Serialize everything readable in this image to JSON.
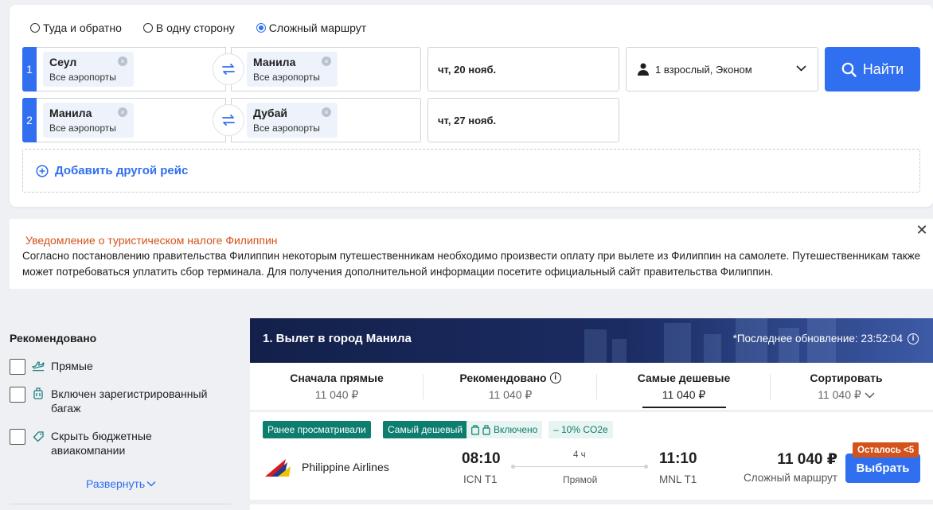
{
  "search": {
    "trip_types": [
      {
        "label": "Туда и обратно",
        "checked": false
      },
      {
        "label": "В одну сторону",
        "checked": false
      },
      {
        "label": "Сложный маршрут",
        "checked": true
      }
    ],
    "legs": [
      {
        "num": "1",
        "from": {
          "city": "Сеул",
          "sub": "Все аэропорты"
        },
        "to": {
          "city": "Манила",
          "sub": "Все аэропорты"
        },
        "date": "чт, 20 нояб."
      },
      {
        "num": "2",
        "from": {
          "city": "Манила",
          "sub": "Все аэропорты"
        },
        "to": {
          "city": "Дубай",
          "sub": "Все аэропорты"
        },
        "date": "чт, 27 нояб."
      }
    ],
    "passengers": "1 взрослый, Эконом",
    "search_label": "Найти",
    "add_flight_label": "Добавить другой рейс",
    "accent_color": "#2f6ff0"
  },
  "notice": {
    "title": "Уведомление о туристическом налоге Филиппин",
    "body": "Согласно постановлению правительства Филиппин некоторым путешественникам необходимо произвести оплату при вылете из Филиппин на самолете. Путешественникам также может потребоваться уплатить сбор терминала. Для получения дополнительной информации посетите официальный сайт правительства Филиппин.",
    "title_color": "#d4531b"
  },
  "filters": {
    "title": "Рекомендовано",
    "items": [
      {
        "label": "Прямые",
        "icon": "plane-icon"
      },
      {
        "label": "Включен зарегистрированный багаж",
        "icon": "luggage-icon"
      },
      {
        "label": "Скрыть бюджетные авиакомпании",
        "icon": "tag-icon"
      }
    ],
    "expand_label": "Развернуть"
  },
  "results": {
    "title": "1. Вылет в город Манила",
    "last_update": "*Последнее обновление: 23:52:04",
    "sort_tabs": [
      {
        "label": "Сначала прямые",
        "price": "11 040 ₽",
        "active": false
      },
      {
        "label": "Рекомендовано",
        "price": "11 040 ₽",
        "active": false,
        "info": true
      },
      {
        "label": "Самые дешевые",
        "price": "11 040 ₽",
        "active": true
      },
      {
        "label": "Сортировать",
        "price": "11 040 ₽",
        "active": false,
        "dropdown": true
      }
    ],
    "flight": {
      "tags": [
        "Ранее просматривали",
        "Самый дешевый",
        "Включено",
        "– 10% CO2e"
      ],
      "airline": "Philippine Airlines",
      "depart_time": "08:10",
      "depart_airport": "ICN T1",
      "duration": "4 ч",
      "stops": "Прямой",
      "arrive_time": "11:10",
      "arrive_airport": "MNL T1",
      "price": "11 040 ₽",
      "price_sub": "Сложный маршрут",
      "seats_badge": "Осталось <5",
      "select_label": "Выбрать"
    }
  }
}
